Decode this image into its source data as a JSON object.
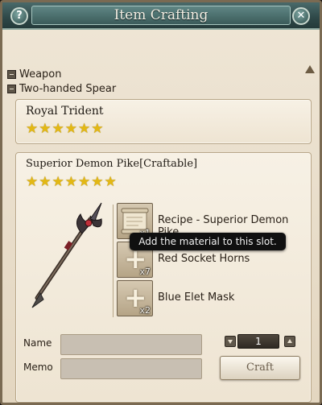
{
  "window": {
    "title": "Item Crafting",
    "help_label": "?",
    "close_label": "✕"
  },
  "tree": {
    "category": "Weapon",
    "subcategory": "Two-handed Spear"
  },
  "items": [
    {
      "name": "Royal Trident",
      "stars": "★★★★★★",
      "star_count": 6
    },
    {
      "name": "Superior Demon Pike[Craftable]",
      "stars": "★★★★★★★",
      "star_count": 7
    }
  ],
  "materials": [
    {
      "label": "Recipe - Superior Demon Pike",
      "qty": "x1",
      "icon": "recipe-scroll-icon"
    },
    {
      "label": "Red Socket Horns",
      "qty": "x7",
      "icon": "add-plus-icon",
      "plus": "+"
    },
    {
      "label": "Blue Elet Mask",
      "qty": "x2",
      "icon": "add-plus-icon",
      "plus": "+"
    }
  ],
  "tooltip": "Add the material to this slot.",
  "form": {
    "name_label": "Name",
    "name_value": "",
    "memo_label": "Memo",
    "memo_value": ""
  },
  "quantity": "1",
  "craft_label": "Craft",
  "colors": {
    "titlebar": "#2e4848",
    "panel_bg": "#f7f1e5",
    "star": "#e3b814",
    "tooltip_bg": "#101010"
  }
}
